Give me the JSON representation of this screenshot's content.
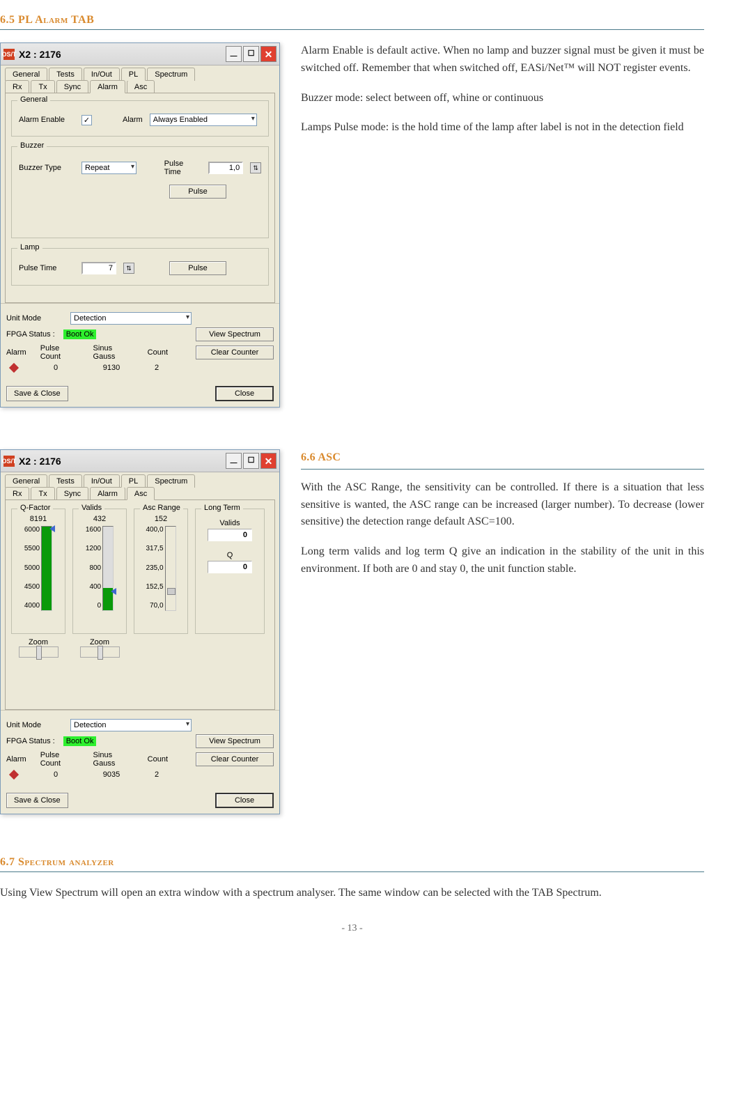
{
  "headings": {
    "s65": "6.5 PL Alarm TAB",
    "s66": "6.6 ASC",
    "s67": "6.7 Spectrum analyzer"
  },
  "desc65": {
    "p1": "Alarm Enable is default active. When no lamp and buzzer signal must be given it must be switched off. Remember that when switched off, EASi/Net™ will NOT register events.",
    "p2": "Buzzer mode: select between off, whine or continuous",
    "p3": "Lamps Pulse mode: is the hold time of the lamp after label is not in the detection field"
  },
  "desc66": {
    "p1": "With the ASC Range, the sensitivity can be controlled. If there is a situation that less sensitive is wanted, the ASC range can be increased (larger number). To decrease (lower sensitive) the detection range default ASC=100.",
    "p2": "Long term valids and log term Q give an indication in the stability of the unit in this environment. If both are 0 and stay 0, the unit function stable."
  },
  "desc67": {
    "p1": "Using View Spectrum will open an extra window with a spectrum analyser. The same window can be selected with the TAB Spectrum."
  },
  "dlg": {
    "title": "X2 : 2176",
    "app_icon": "OS/T",
    "tabs_top": [
      "General",
      "Tests",
      "In/Out",
      "PL",
      "Spectrum"
    ],
    "tabs_sub": [
      "Rx",
      "Tx",
      "Sync",
      "Alarm",
      "Asc"
    ],
    "general": {
      "legend": "General",
      "alarm_enable_label": "Alarm Enable",
      "alarm_enable_checked": "✓",
      "alarm_label": "Alarm",
      "alarm_combo": "Always Enabled"
    },
    "buzzer": {
      "legend": "Buzzer",
      "type_label": "Buzzer Type",
      "type_combo": "Repeat",
      "pulse_time_label": "Pulse Time",
      "pulse_time_value": "1,0",
      "pulse_button": "Pulse"
    },
    "lamp": {
      "legend": "Lamp",
      "pulse_time_label": "Pulse Time",
      "pulse_time_value": "7",
      "pulse_button": "Pulse"
    },
    "status": {
      "unit_mode_label": "Unit Mode",
      "unit_mode_value": "Detection",
      "fpga_label": "FPGA Status :",
      "fpga_value": "Boot Ok",
      "view_spectrum": "View Spectrum",
      "clear_counter": "Clear Counter",
      "alarm_hdr": "Alarm",
      "pulse_count_hdr": "Pulse Count",
      "sinus_gauss_hdr": "Sinus Gauss",
      "count_hdr": "Count",
      "pulse_count": "0",
      "sinus_gauss": "9130",
      "count": "2"
    },
    "footer": {
      "save_close": "Save & Close",
      "close": "Close"
    }
  },
  "dlg2": {
    "title": "X2 : 2176",
    "tabs_top": [
      "General",
      "Tests",
      "In/Out",
      "PL",
      "Spectrum"
    ],
    "tabs_sub": [
      "Rx",
      "Tx",
      "Sync",
      "Alarm",
      "Asc"
    ],
    "asc": {
      "qfactor_label": "Q-Factor",
      "qfactor_value": "8191",
      "qfactor_ticks": [
        "6000",
        "5500",
        "5000",
        "4500",
        "4000"
      ],
      "valids_label": "Valids",
      "valids_value": "432",
      "valids_ticks": [
        "1600",
        "1200",
        "800",
        "400",
        "0"
      ],
      "ascrange_label": "Asc Range",
      "ascrange_value": "152",
      "ascrange_ticks": [
        "400,0",
        "317,5",
        "235,0",
        "152,5",
        "70,0"
      ],
      "longterm_label": "Long Term",
      "lt_valids_label": "Valids",
      "lt_valids_value": "0",
      "lt_q_label": "Q",
      "lt_q_value": "0",
      "zoom_label": "Zoom"
    },
    "status": {
      "pulse_count": "0",
      "sinus_gauss": "9035",
      "count": "2"
    }
  },
  "page_number": "- 13 -"
}
